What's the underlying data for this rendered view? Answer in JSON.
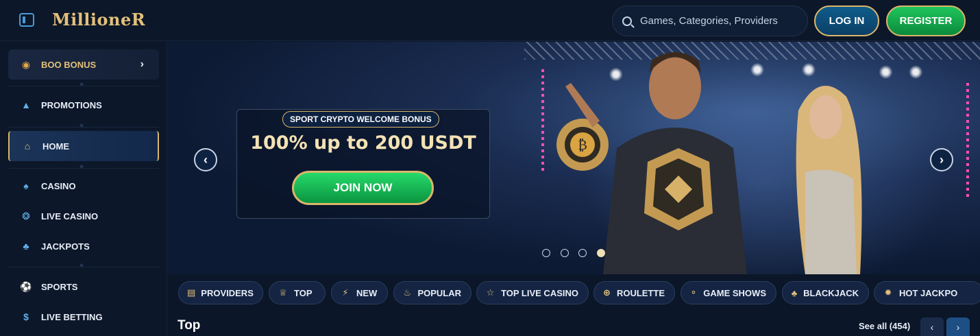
{
  "header": {
    "logo": "MillioneR",
    "search_placeholder": "Games, Categories, Providers",
    "login_label": "LOG IN",
    "register_label": "REGISTER"
  },
  "sidebar": {
    "items": [
      {
        "label": "BOO BONUS",
        "icon": "pumpkin-icon"
      },
      {
        "label": "PROMOTIONS",
        "icon": "megaphone-icon"
      },
      {
        "label": "HOME",
        "icon": "home-icon"
      },
      {
        "label": "CASINO",
        "icon": "spade-icon"
      },
      {
        "label": "LIVE CASINO",
        "icon": "chip-icon"
      },
      {
        "label": "JACKPOTS",
        "icon": "clover-icon"
      },
      {
        "label": "SPORTS",
        "icon": "soccer-ball-icon"
      },
      {
        "label": "LIVE BETTING",
        "icon": "dollar-coin-icon"
      }
    ]
  },
  "banner": {
    "tag": "SPORT CRYPTO WELCOME BONUS",
    "title": "100% up to 200 USDT",
    "cta_label": "JOIN NOW",
    "prev_icon": "chevron-left-icon",
    "next_icon": "chevron-right-icon",
    "slides_total": 4,
    "active_slide": 4
  },
  "categories": [
    {
      "label": "PROVIDERS",
      "icon": "book-icon"
    },
    {
      "label": "TOP",
      "icon": "crown-icon"
    },
    {
      "label": "NEW",
      "icon": "lightning-icon"
    },
    {
      "label": "POPULAR",
      "icon": "flame-icon"
    },
    {
      "label": "TOP LIVE CASINO",
      "icon": "star-icon"
    },
    {
      "label": "ROULETTE",
      "icon": "roulette-icon"
    },
    {
      "label": "GAME SHOWS",
      "icon": "microphone-icon"
    },
    {
      "label": "BLACKJACK",
      "icon": "cards-icon"
    },
    {
      "label": "HOT JACKPO",
      "icon": "horn-icon"
    }
  ],
  "section": {
    "title": "Top",
    "see_all": "See all (454)"
  },
  "colors": {
    "background": "#0b1628",
    "gold": "#d9b66a",
    "green": "#1fc55d",
    "blue_accent": "#4a9bd8"
  }
}
